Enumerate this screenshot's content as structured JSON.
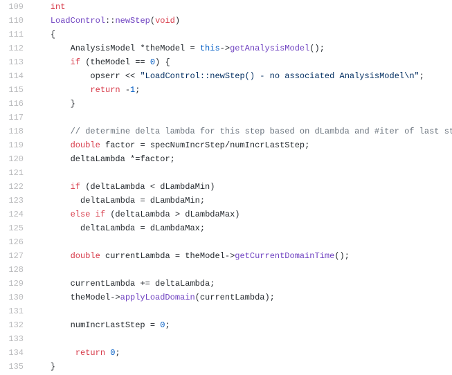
{
  "lines": [
    {
      "no": "109",
      "tokens": [
        [
          "sp",
          "    "
        ],
        [
          "kw",
          "int"
        ]
      ]
    },
    {
      "no": "110",
      "tokens": [
        [
          "sp",
          "    "
        ],
        [
          "cls",
          "LoadControl"
        ],
        [
          "op",
          "::"
        ],
        [
          "fn",
          "newStep"
        ],
        [
          "op",
          "("
        ],
        [
          "kw",
          "void"
        ],
        [
          "op",
          ")"
        ]
      ]
    },
    {
      "no": "111",
      "tokens": [
        [
          "sp",
          "    "
        ],
        [
          "op",
          "{"
        ]
      ]
    },
    {
      "no": "112",
      "tokens": [
        [
          "sp",
          "        "
        ],
        [
          "id",
          "AnalysisModel "
        ],
        [
          "op",
          "*"
        ],
        [
          "id",
          "theModel "
        ],
        [
          "op",
          "= "
        ],
        [
          "this",
          "this"
        ],
        [
          "op",
          "->"
        ],
        [
          "call",
          "getAnalysisModel"
        ],
        [
          "op",
          "();"
        ]
      ]
    },
    {
      "no": "113",
      "tokens": [
        [
          "sp",
          "        "
        ],
        [
          "kw",
          "if"
        ],
        [
          "id",
          " (theModel "
        ],
        [
          "op",
          "== "
        ],
        [
          "num",
          "0"
        ],
        [
          "id",
          ") {"
        ]
      ]
    },
    {
      "no": "114",
      "tokens": [
        [
          "sp",
          "            "
        ],
        [
          "id",
          "opserr "
        ],
        [
          "op",
          "<< "
        ],
        [
          "str",
          "\"LoadControl::newStep() - no associated AnalysisModel\\n\""
        ],
        [
          "op",
          ";"
        ]
      ]
    },
    {
      "no": "115",
      "tokens": [
        [
          "sp",
          "            "
        ],
        [
          "kw",
          "return"
        ],
        [
          "id",
          " "
        ],
        [
          "op",
          "-"
        ],
        [
          "num",
          "1"
        ],
        [
          "op",
          ";"
        ]
      ]
    },
    {
      "no": "116",
      "tokens": [
        [
          "sp",
          "        "
        ],
        [
          "op",
          "}"
        ]
      ]
    },
    {
      "no": "117",
      "tokens": []
    },
    {
      "no": "118",
      "tokens": [
        [
          "sp",
          "        "
        ],
        [
          "cm",
          "// determine delta lambda for this step based on dLambda and #iter of last step"
        ]
      ]
    },
    {
      "no": "119",
      "tokens": [
        [
          "sp",
          "        "
        ],
        [
          "kw",
          "double"
        ],
        [
          "id",
          " factor "
        ],
        [
          "op",
          "= "
        ],
        [
          "id",
          "specNumIncrStep"
        ],
        [
          "op",
          "/"
        ],
        [
          "id",
          "numIncrLastStep;"
        ]
      ]
    },
    {
      "no": "120",
      "tokens": [
        [
          "sp",
          "        "
        ],
        [
          "id",
          "deltaLambda "
        ],
        [
          "op",
          "*="
        ],
        [
          "id",
          "factor;"
        ]
      ]
    },
    {
      "no": "121",
      "tokens": []
    },
    {
      "no": "122",
      "tokens": [
        [
          "sp",
          "        "
        ],
        [
          "kw",
          "if"
        ],
        [
          "id",
          " (deltaLambda "
        ],
        [
          "op",
          "< "
        ],
        [
          "id",
          "dLambdaMin)"
        ]
      ]
    },
    {
      "no": "123",
      "tokens": [
        [
          "sp",
          "          "
        ],
        [
          "id",
          "deltaLambda "
        ],
        [
          "op",
          "= "
        ],
        [
          "id",
          "dLambdaMin;"
        ]
      ]
    },
    {
      "no": "124",
      "tokens": [
        [
          "sp",
          "        "
        ],
        [
          "kw",
          "else"
        ],
        [
          "id",
          " "
        ],
        [
          "kw",
          "if"
        ],
        [
          "id",
          " (deltaLambda "
        ],
        [
          "op",
          "> "
        ],
        [
          "id",
          "dLambdaMax)"
        ]
      ]
    },
    {
      "no": "125",
      "tokens": [
        [
          "sp",
          "          "
        ],
        [
          "id",
          "deltaLambda "
        ],
        [
          "op",
          "= "
        ],
        [
          "id",
          "dLambdaMax;"
        ]
      ]
    },
    {
      "no": "126",
      "tokens": []
    },
    {
      "no": "127",
      "tokens": [
        [
          "sp",
          "        "
        ],
        [
          "kw",
          "double"
        ],
        [
          "id",
          " currentLambda "
        ],
        [
          "op",
          "= "
        ],
        [
          "id",
          "theModel"
        ],
        [
          "op",
          "->"
        ],
        [
          "call",
          "getCurrentDomainTime"
        ],
        [
          "op",
          "();"
        ]
      ]
    },
    {
      "no": "128",
      "tokens": []
    },
    {
      "no": "129",
      "tokens": [
        [
          "sp",
          "        "
        ],
        [
          "id",
          "currentLambda "
        ],
        [
          "op",
          "+= "
        ],
        [
          "id",
          "deltaLambda;"
        ]
      ]
    },
    {
      "no": "130",
      "tokens": [
        [
          "sp",
          "        "
        ],
        [
          "id",
          "theModel"
        ],
        [
          "op",
          "->"
        ],
        [
          "call",
          "applyLoadDomain"
        ],
        [
          "op",
          "("
        ],
        [
          "id",
          "currentLambda"
        ],
        [
          "op",
          ");"
        ]
      ]
    },
    {
      "no": "131",
      "tokens": []
    },
    {
      "no": "132",
      "tokens": [
        [
          "sp",
          "        "
        ],
        [
          "id",
          "numIncrLastStep "
        ],
        [
          "op",
          "= "
        ],
        [
          "num",
          "0"
        ],
        [
          "op",
          ";"
        ]
      ]
    },
    {
      "no": "133",
      "tokens": []
    },
    {
      "no": "134",
      "tokens": [
        [
          "sp",
          "         "
        ],
        [
          "kw",
          "return"
        ],
        [
          "id",
          " "
        ],
        [
          "num",
          "0"
        ],
        [
          "op",
          ";"
        ]
      ]
    },
    {
      "no": "135",
      "tokens": [
        [
          "sp",
          "    "
        ],
        [
          "op",
          "}"
        ]
      ]
    }
  ]
}
